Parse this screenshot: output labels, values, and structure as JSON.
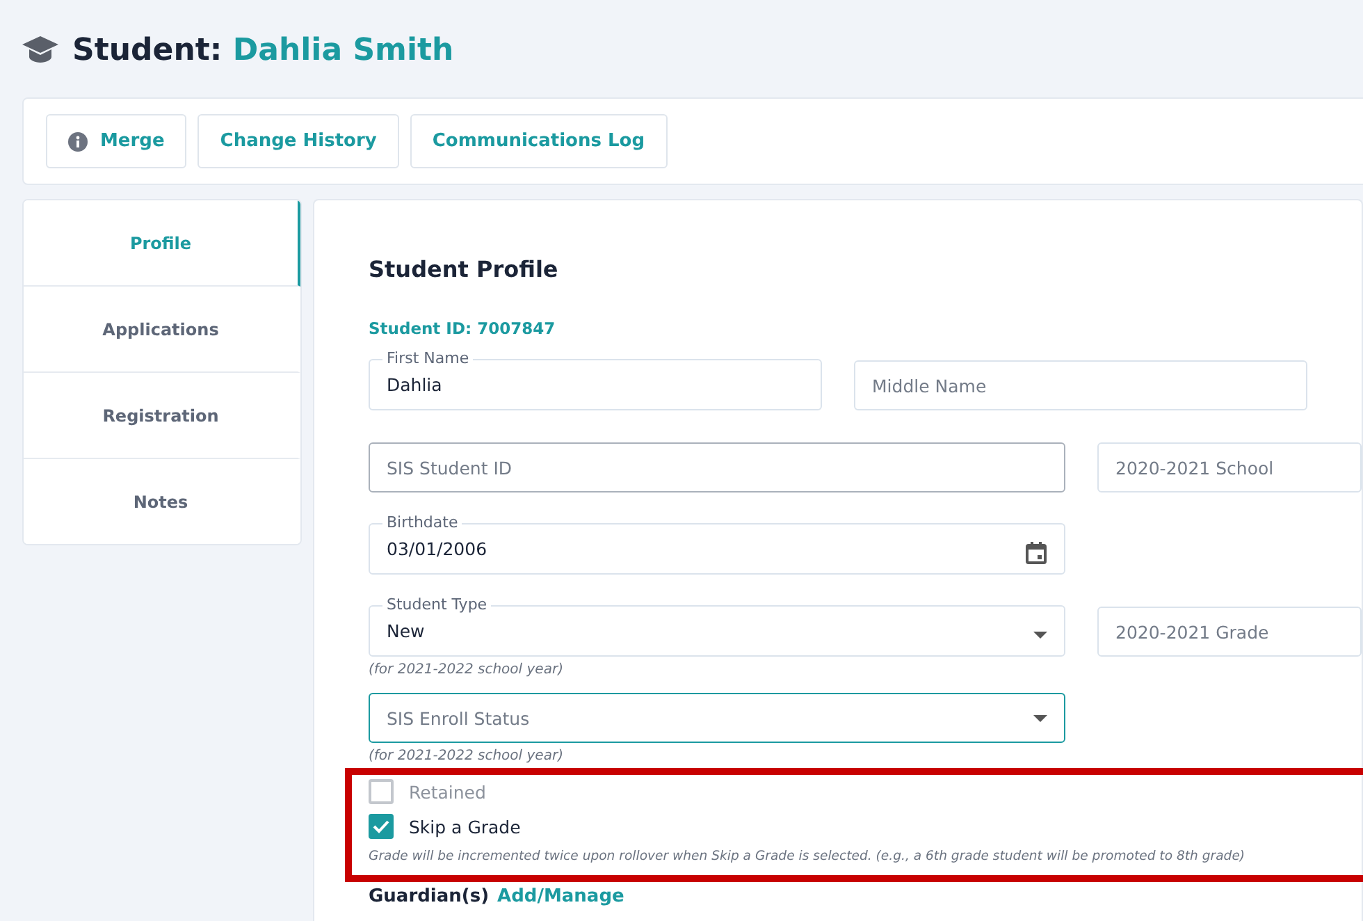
{
  "title": {
    "prefix": "Student:",
    "name": "Dahlia Smith"
  },
  "actions": [
    {
      "label": "Merge",
      "kind": "info"
    },
    {
      "label": "Change History",
      "kind": "plain"
    },
    {
      "label": "Communications Log",
      "kind": "plain"
    }
  ],
  "tabs": [
    {
      "label": "Profile",
      "selected": true
    },
    {
      "label": "Applications",
      "selected": false
    },
    {
      "label": "Registration",
      "selected": false
    },
    {
      "label": "Notes",
      "selected": false
    }
  ],
  "profile": {
    "heading": "Student Profile",
    "student_id": "Student ID: 7007847",
    "rows": [
      {
        "fields": [
          {
            "kind": "text",
            "label": "First Name",
            "value": "Dahlia",
            "focused": false,
            "outlined": false
          },
          {
            "kind": "text",
            "placeholder": "Middle Name",
            "focused": false,
            "outlined": false
          }
        ]
      },
      {
        "fields": [
          {
            "kind": "text",
            "placeholder": "SIS Student ID",
            "focused": false,
            "outlined": true
          },
          {
            "kind": "text",
            "placeholder": "2020-2021 School",
            "focused": false,
            "outlined": false
          }
        ]
      },
      {
        "fields": [
          {
            "kind": "date",
            "label": "Birthdate",
            "value": "03/01/2006",
            "focused": false,
            "outlined": false
          }
        ]
      },
      {
        "fields": [
          {
            "kind": "select",
            "label": "Student Type",
            "value": "New",
            "focused": false,
            "outlined": false
          },
          {
            "kind": "text",
            "placeholder": "2020-2021 Grade",
            "focused": false,
            "outlined": false
          }
        ],
        "hint": "(for 2021-2022 school year)"
      },
      {
        "fields": [
          {
            "kind": "select",
            "placeholder": "SIS Enroll Status",
            "focused": true,
            "outlined": false
          }
        ],
        "hint": "(for 2021-2022 school year)"
      }
    ],
    "checkboxes": [
      {
        "label": "Retained",
        "checked": false,
        "disabled": true
      },
      {
        "label": "Skip a Grade",
        "checked": true,
        "disabled": false
      }
    ],
    "note": "Grade will be incremented twice upon rollover when Skip a Grade is selected. (e.g., a 6th grade student will be promoted to 8th grade)",
    "guardians": {
      "label": "Guardian(s)",
      "link": "Add/Manage"
    }
  }
}
